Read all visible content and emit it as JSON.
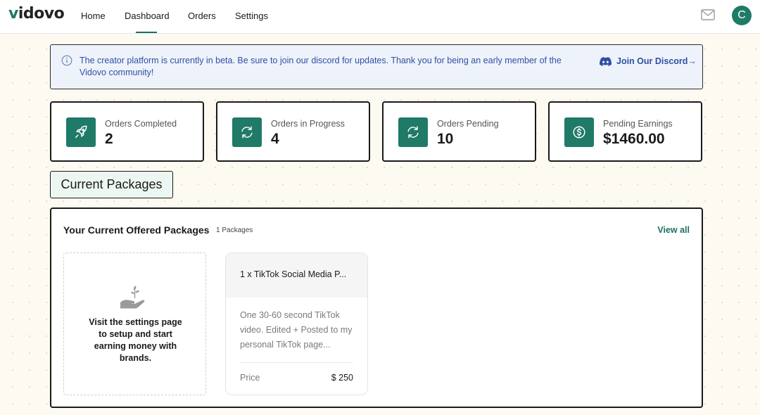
{
  "brand": {
    "logo_text_accent": "v",
    "logo_text_rest": "idovo",
    "accent_color": "#1f7a67"
  },
  "nav": {
    "items": [
      {
        "label": "Home"
      },
      {
        "label": "Dashboard",
        "active": true
      },
      {
        "label": "Orders"
      },
      {
        "label": "Settings"
      }
    ],
    "mail_icon": "mail-icon",
    "avatar_initial": "C"
  },
  "banner": {
    "icon": "info-icon",
    "text": "The creator platform is currently in beta. Be sure to join our discord for updates. Thank you for being an early member of the Vidovo community!",
    "link_icon": "discord-icon",
    "link_label": "Join Our Discord",
    "link_arrow": "→"
  },
  "stats": [
    {
      "icon": "rocket-icon",
      "label": "Orders Completed",
      "value": "2"
    },
    {
      "icon": "refresh-icon",
      "label": "Orders in Progress",
      "value": "4"
    },
    {
      "icon": "refresh-icon",
      "label": "Orders Pending",
      "value": "10"
    },
    {
      "icon": "dollar-icon",
      "label": "Pending Earnings",
      "value": "$1460.00"
    }
  ],
  "section_tab": "Current Packages",
  "packages_panel": {
    "title": "Your Current Offered Packages",
    "count": "1 Packages",
    "view_all": "View all",
    "empty_card": {
      "icon": "plant-hand-icon",
      "text": "Visit the settings page to setup and start earning money with brands."
    },
    "packages": [
      {
        "title": "1 x TikTok Social Media P...",
        "description": "One 30-60 second TikTok video. Edited + Posted to my personal TikTok page...",
        "price_label": "Price",
        "price_value": "$ 250"
      }
    ]
  }
}
